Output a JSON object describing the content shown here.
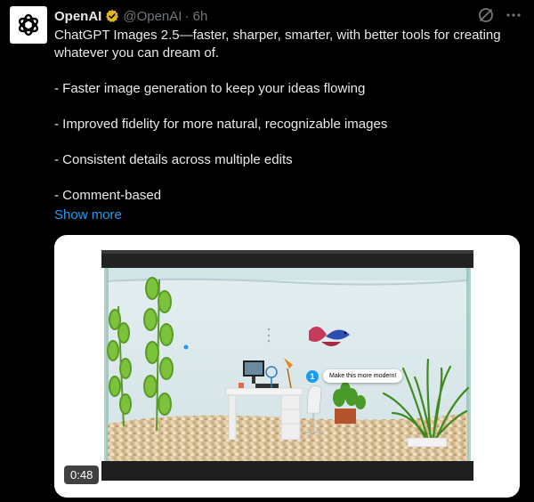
{
  "author": {
    "name": "OpenAI",
    "handle": "@OpenAI",
    "time": "· 6h"
  },
  "tweet": {
    "lines": [
      "ChatGPT Images 2.5—faster, sharper, smarter, with better tools for creating whatever you can dream of.",
      "- Faster image generation to keep your ideas flowing",
      "- Improved fidelity for more natural, recognizable images",
      "- Consistent details across multiple edits",
      "- Comment-based"
    ],
    "show_more": "Show more"
  },
  "media": {
    "duration": "0:48",
    "callout_number": "1",
    "callout_text": "Make this more modern!"
  },
  "colors": {
    "background": "#000000",
    "text": "#e7e9ea",
    "muted": "#71767b",
    "link": "#1d9bf0",
    "verified": "#e2b719"
  },
  "icons": [
    "openai-logo-icon",
    "verified-badge-icon",
    "grok-icon",
    "more-icon"
  ]
}
